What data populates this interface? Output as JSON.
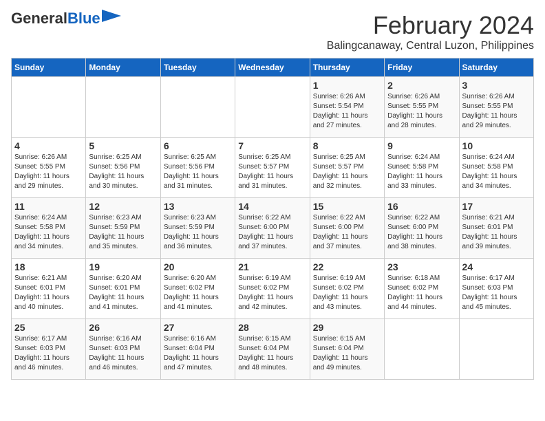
{
  "header": {
    "logo_general": "General",
    "logo_blue": "Blue",
    "month_year": "February 2024",
    "location": "Balingcanaway, Central Luzon, Philippines"
  },
  "weekdays": [
    "Sunday",
    "Monday",
    "Tuesday",
    "Wednesday",
    "Thursday",
    "Friday",
    "Saturday"
  ],
  "weeks": [
    [
      {
        "day": "",
        "info": ""
      },
      {
        "day": "",
        "info": ""
      },
      {
        "day": "",
        "info": ""
      },
      {
        "day": "",
        "info": ""
      },
      {
        "day": "1",
        "info": "Sunrise: 6:26 AM\nSunset: 5:54 PM\nDaylight: 11 hours\nand 27 minutes."
      },
      {
        "day": "2",
        "info": "Sunrise: 6:26 AM\nSunset: 5:55 PM\nDaylight: 11 hours\nand 28 minutes."
      },
      {
        "day": "3",
        "info": "Sunrise: 6:26 AM\nSunset: 5:55 PM\nDaylight: 11 hours\nand 29 minutes."
      }
    ],
    [
      {
        "day": "4",
        "info": "Sunrise: 6:26 AM\nSunset: 5:55 PM\nDaylight: 11 hours\nand 29 minutes."
      },
      {
        "day": "5",
        "info": "Sunrise: 6:25 AM\nSunset: 5:56 PM\nDaylight: 11 hours\nand 30 minutes."
      },
      {
        "day": "6",
        "info": "Sunrise: 6:25 AM\nSunset: 5:56 PM\nDaylight: 11 hours\nand 31 minutes."
      },
      {
        "day": "7",
        "info": "Sunrise: 6:25 AM\nSunset: 5:57 PM\nDaylight: 11 hours\nand 31 minutes."
      },
      {
        "day": "8",
        "info": "Sunrise: 6:25 AM\nSunset: 5:57 PM\nDaylight: 11 hours\nand 32 minutes."
      },
      {
        "day": "9",
        "info": "Sunrise: 6:24 AM\nSunset: 5:58 PM\nDaylight: 11 hours\nand 33 minutes."
      },
      {
        "day": "10",
        "info": "Sunrise: 6:24 AM\nSunset: 5:58 PM\nDaylight: 11 hours\nand 34 minutes."
      }
    ],
    [
      {
        "day": "11",
        "info": "Sunrise: 6:24 AM\nSunset: 5:58 PM\nDaylight: 11 hours\nand 34 minutes."
      },
      {
        "day": "12",
        "info": "Sunrise: 6:23 AM\nSunset: 5:59 PM\nDaylight: 11 hours\nand 35 minutes."
      },
      {
        "day": "13",
        "info": "Sunrise: 6:23 AM\nSunset: 5:59 PM\nDaylight: 11 hours\nand 36 minutes."
      },
      {
        "day": "14",
        "info": "Sunrise: 6:22 AM\nSunset: 6:00 PM\nDaylight: 11 hours\nand 37 minutes."
      },
      {
        "day": "15",
        "info": "Sunrise: 6:22 AM\nSunset: 6:00 PM\nDaylight: 11 hours\nand 37 minutes."
      },
      {
        "day": "16",
        "info": "Sunrise: 6:22 AM\nSunset: 6:00 PM\nDaylight: 11 hours\nand 38 minutes."
      },
      {
        "day": "17",
        "info": "Sunrise: 6:21 AM\nSunset: 6:01 PM\nDaylight: 11 hours\nand 39 minutes."
      }
    ],
    [
      {
        "day": "18",
        "info": "Sunrise: 6:21 AM\nSunset: 6:01 PM\nDaylight: 11 hours\nand 40 minutes."
      },
      {
        "day": "19",
        "info": "Sunrise: 6:20 AM\nSunset: 6:01 PM\nDaylight: 11 hours\nand 41 minutes."
      },
      {
        "day": "20",
        "info": "Sunrise: 6:20 AM\nSunset: 6:02 PM\nDaylight: 11 hours\nand 41 minutes."
      },
      {
        "day": "21",
        "info": "Sunrise: 6:19 AM\nSunset: 6:02 PM\nDaylight: 11 hours\nand 42 minutes."
      },
      {
        "day": "22",
        "info": "Sunrise: 6:19 AM\nSunset: 6:02 PM\nDaylight: 11 hours\nand 43 minutes."
      },
      {
        "day": "23",
        "info": "Sunrise: 6:18 AM\nSunset: 6:02 PM\nDaylight: 11 hours\nand 44 minutes."
      },
      {
        "day": "24",
        "info": "Sunrise: 6:17 AM\nSunset: 6:03 PM\nDaylight: 11 hours\nand 45 minutes."
      }
    ],
    [
      {
        "day": "25",
        "info": "Sunrise: 6:17 AM\nSunset: 6:03 PM\nDaylight: 11 hours\nand 46 minutes."
      },
      {
        "day": "26",
        "info": "Sunrise: 6:16 AM\nSunset: 6:03 PM\nDaylight: 11 hours\nand 46 minutes."
      },
      {
        "day": "27",
        "info": "Sunrise: 6:16 AM\nSunset: 6:04 PM\nDaylight: 11 hours\nand 47 minutes."
      },
      {
        "day": "28",
        "info": "Sunrise: 6:15 AM\nSunset: 6:04 PM\nDaylight: 11 hours\nand 48 minutes."
      },
      {
        "day": "29",
        "info": "Sunrise: 6:15 AM\nSunset: 6:04 PM\nDaylight: 11 hours\nand 49 minutes."
      },
      {
        "day": "",
        "info": ""
      },
      {
        "day": "",
        "info": ""
      }
    ]
  ]
}
